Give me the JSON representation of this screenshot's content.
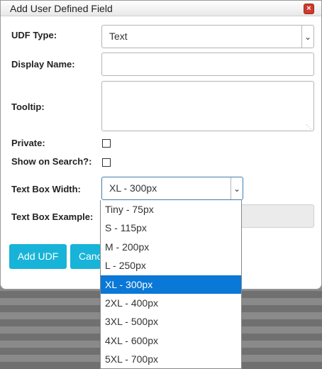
{
  "dialog": {
    "title": "Add User Defined Field",
    "close_glyph": "×"
  },
  "form": {
    "udf_type_label": "UDF Type:",
    "udf_type_value": "Text",
    "display_name_label": "Display Name:",
    "display_name_value": "",
    "tooltip_label": "Tooltip:",
    "tooltip_value": "",
    "private_label": "Private:",
    "private_checked": false,
    "show_on_search_label": "Show on Search?:",
    "show_on_search_checked": false,
    "text_box_width_label": "Text Box Width:",
    "text_box_width_value": "XL - 300px",
    "text_box_example_label": "Text Box Example:"
  },
  "buttons": {
    "add_udf": "Add UDF",
    "cancel": "Canc"
  },
  "width_dropdown": {
    "selected_index": 4,
    "options": [
      "Tiny - 75px",
      "S - 115px",
      "M - 200px",
      "L - 250px",
      "XL - 300px",
      "2XL - 400px",
      "3XL - 500px",
      "4XL - 600px",
      "5XL - 700px"
    ]
  },
  "colors": {
    "button_bg": "#18b3d8",
    "selected_option_bg": "#0a78d6",
    "close_button_bg": "#d0392b"
  }
}
